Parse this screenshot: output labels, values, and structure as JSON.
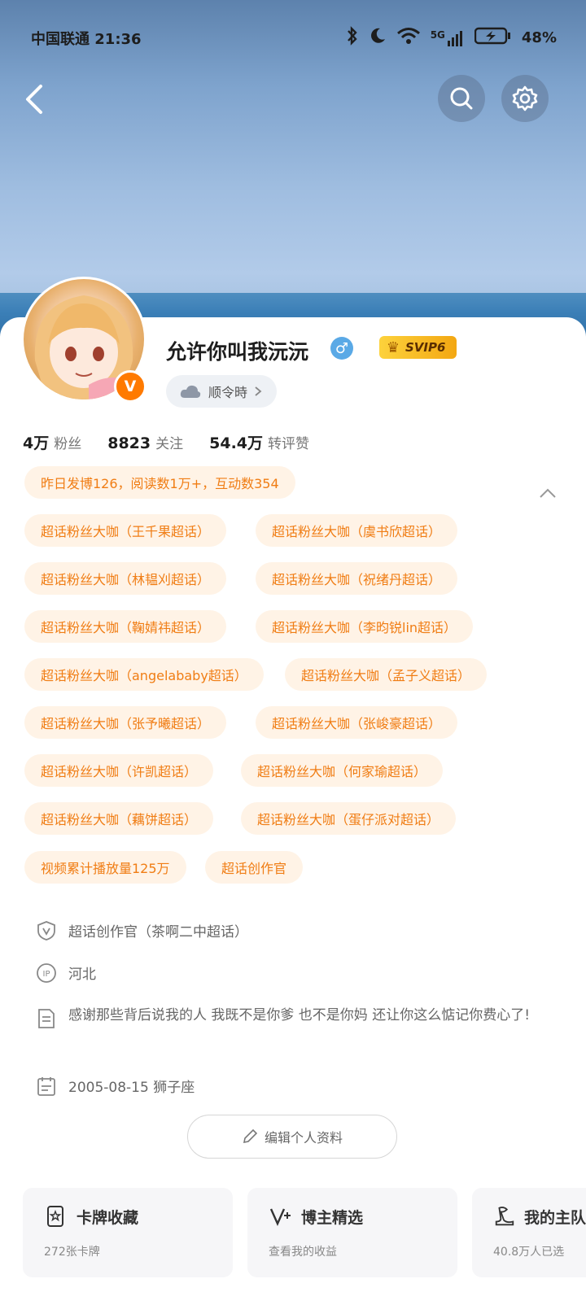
{
  "status_bar": {
    "carrier_time": "中国联通 21:36",
    "signal": "5G",
    "battery": "48%"
  },
  "profile": {
    "username": "允许你叫我沅沅",
    "svip": "SVIP6",
    "weather": "顺令時",
    "stats": [
      {
        "value": "4万",
        "label": "粉丝"
      },
      {
        "value": "8823",
        "label": "关注"
      },
      {
        "value": "54.4万",
        "label": "转评赞"
      }
    ],
    "summary_tag": "昨日发博126，阅读数1万+，互动数354",
    "tags": [
      "超话粉丝大咖（王千果超话）",
      "超话粉丝大咖（虞书欣超话）",
      "超话粉丝大咖（林韫刈超话）",
      "超话粉丝大咖（祝绪丹超话）",
      "超话粉丝大咖（鞠婧祎超话）",
      "超话粉丝大咖（李昀锐lin超话）",
      "超话粉丝大咖（angelababy超话）",
      "超话粉丝大咖（孟子义超话）",
      "超话粉丝大咖（张予曦超话）",
      "超话粉丝大咖（张峻豪超话）",
      "超话粉丝大咖（许凯超话）",
      "超话粉丝大咖（何家瑜超话）",
      "超话粉丝大咖（藕饼超话）",
      "超话粉丝大咖（蛋仔派对超话）",
      "视频累计播放量125万",
      "超话创作官"
    ],
    "info": {
      "creator": "超话创作官（茶啊二中超话）",
      "ip_label": "IP",
      "ip": "河北",
      "bio": "感谢那些背后说我的人 我既不是你爹 也不是你妈 还让你这么惦记你费心了!",
      "birthday": "2005-08-15 狮子座"
    },
    "edit_button": "编辑个人资料"
  },
  "features": [
    {
      "title": "卡牌收藏",
      "sub": "272张卡牌"
    },
    {
      "title": "博主精选",
      "sub": "查看我的收益"
    },
    {
      "title": "我的主队",
      "sub": "40.8万人已选"
    }
  ],
  "colors": {
    "accent": "#f07d14",
    "tag_bg": "#fff3e6",
    "svip": "#f3a712"
  }
}
